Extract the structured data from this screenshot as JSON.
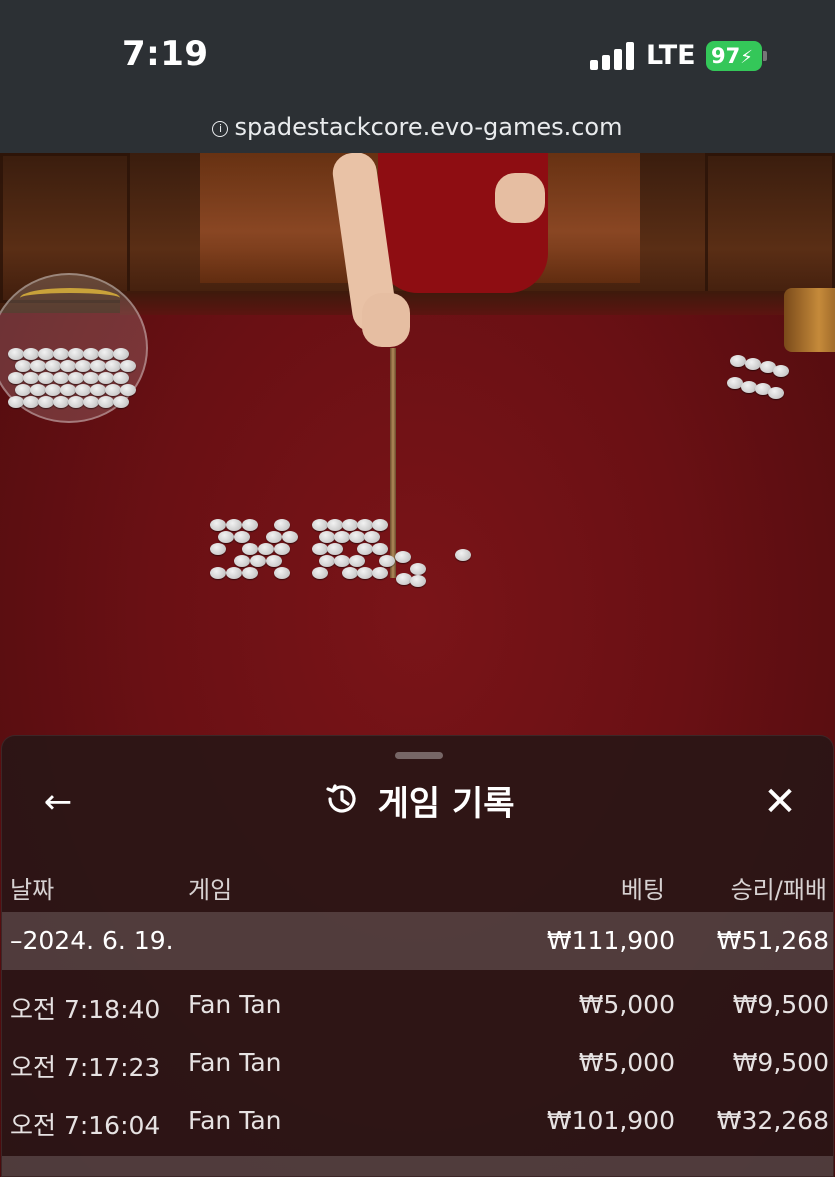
{
  "status_bar": {
    "time": "7:19",
    "network": "LTE",
    "battery": "97",
    "url": "spadestackcore.evo-games.com",
    "icons": [
      "signal-bars-icon",
      "battery-charging-icon",
      "info-icon"
    ]
  },
  "sheet": {
    "title": "게임 기록",
    "icons": [
      "back-arrow-icon",
      "history-icon",
      "close-icon"
    ],
    "columns": {
      "date": "날짜",
      "game": "게임",
      "bet": "베팅",
      "win_loss": "승리/패배"
    },
    "groups": [
      {
        "date": "–2024. 6. 19.",
        "bet": "₩111,900",
        "win_loss": "₩51,268",
        "rows": [
          {
            "time": "오전 7:18:40",
            "game": "Fan Tan",
            "bet": "₩5,000",
            "win_loss": "₩9,500"
          },
          {
            "time": "오전 7:17:23",
            "game": "Fan Tan",
            "bet": "₩5,000",
            "win_loss": "₩9,500"
          },
          {
            "time": "오전 7:16:04",
            "game": "Fan Tan",
            "bet": "₩101,900",
            "win_loss": "₩32,268"
          }
        ]
      }
    ]
  },
  "colors": {
    "status_bg": "#2c3034",
    "battery_green": "#34c759",
    "table_felt": "#6a1014",
    "sheet_bg": "#2a1616"
  }
}
